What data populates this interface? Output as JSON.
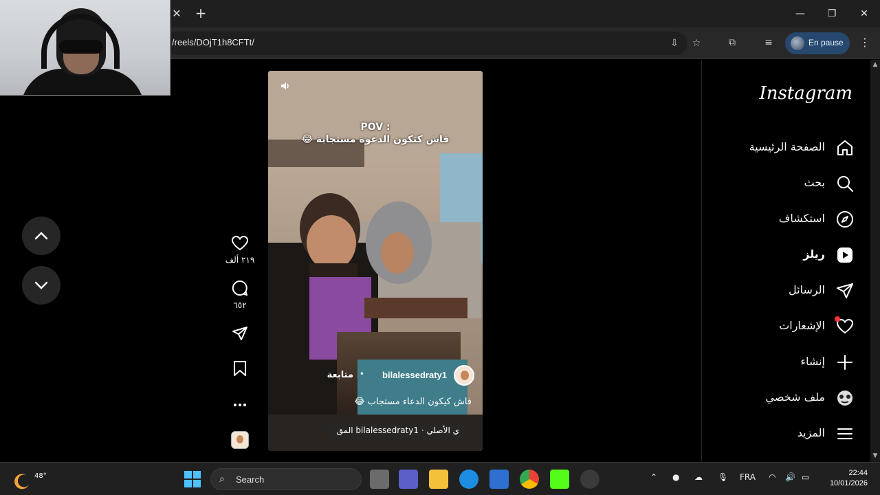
{
  "browser": {
    "url": "/reels/DOjT1h8CFTt/",
    "profile_label": "En pause"
  },
  "reel": {
    "caption_pov": "POV :",
    "caption_main": "فاش كتكون الدعوة مستجابة 😂",
    "author": "bilalessedraty1",
    "follow_label": "متابعة",
    "description": "فاش كيكون الدعاء مستجاب 😂",
    "audio": "ي الأصلي · bilalessedraty1 المق"
  },
  "actions": {
    "likes": "٢١٩ ألف",
    "comments": "٦٥٢"
  },
  "sidebar": {
    "logo": "Instagram",
    "items": [
      {
        "label": "الصفحة الرئيسية",
        "icon": "home-icon"
      },
      {
        "label": "بحث",
        "icon": "search-icon"
      },
      {
        "label": "استكشاف",
        "icon": "compass-icon"
      },
      {
        "label": "ريلز",
        "icon": "reels-icon"
      },
      {
        "label": "الرسائل",
        "icon": "send-icon"
      },
      {
        "label": "الإشعارات",
        "icon": "heart-icon"
      },
      {
        "label": "إنشاء",
        "icon": "plus-icon"
      },
      {
        "label": "ملف شخصي",
        "icon": "profile-avatar-icon"
      },
      {
        "label": "المزيد",
        "icon": "menu-icon"
      }
    ]
  },
  "taskbar": {
    "weather_temp": "48°",
    "search_placeholder": "Search",
    "language": "FRA",
    "time": "22:44",
    "date": "10/01/2026"
  },
  "colors": {
    "ig_bg": "#000000",
    "profile_pill": "#27486e",
    "notification_dot": "#ff3040",
    "taskbar": "#202020"
  }
}
